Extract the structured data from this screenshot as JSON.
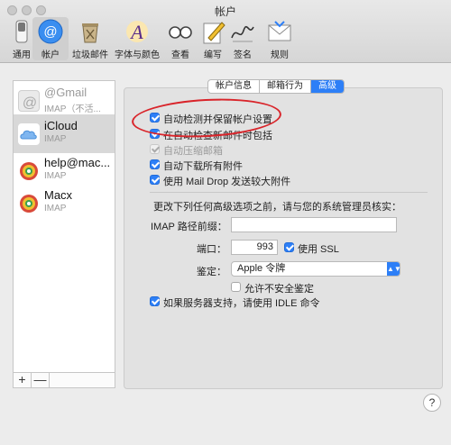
{
  "window": {
    "title": "帐户"
  },
  "toolbar": {
    "items": [
      {
        "label": "通用",
        "icon": "switch-icon"
      },
      {
        "label": "帐户",
        "icon": "at-sign-icon",
        "selected": true
      },
      {
        "label": "垃圾邮件",
        "icon": "trash-bin-icon"
      },
      {
        "label": "字体与颜色",
        "icon": "font-a-icon"
      },
      {
        "label": "查看",
        "icon": "glasses-icon"
      },
      {
        "label": "编写",
        "icon": "pencil-paper-icon"
      },
      {
        "label": "签名",
        "icon": "signature-icon"
      },
      {
        "label": "规则",
        "icon": "envelope-rules-icon"
      }
    ]
  },
  "accounts": [
    {
      "name": "@Gmail",
      "sub": "IMAP（不活...",
      "icon": "gmail-icon",
      "disabled": true
    },
    {
      "name": "iCloud",
      "sub": "IMAP",
      "icon": "icloud-icon",
      "selected": true
    },
    {
      "name": "help@mac...",
      "sub": "IMAP",
      "icon": "mail-account-icon"
    },
    {
      "name": "Macx",
      "sub": "IMAP",
      "icon": "mail-account-icon"
    }
  ],
  "sidebar_buttons": {
    "add": "+",
    "remove": "—"
  },
  "tabs": [
    {
      "label": "帐户信息"
    },
    {
      "label": "邮箱行为"
    },
    {
      "label": "高级",
      "active": true
    }
  ],
  "options": [
    {
      "label": "自动检测并保留帐户设置",
      "state": "on"
    },
    {
      "label": "在自动检查新邮件时包括",
      "state": "on"
    },
    {
      "label": "自动压缩邮箱",
      "state": "dim"
    },
    {
      "label": "自动下载所有附件",
      "state": "on"
    },
    {
      "label": "使用 Mail Drop 发送较大附件",
      "state": "on"
    }
  ],
  "advanced_note": "更改下列任何高级选项之前，请与您的系统管理员核实：",
  "imap_prefix": {
    "label": "IMAP 路径前缀：",
    "value": ""
  },
  "port": {
    "label": "端口：",
    "value": "993"
  },
  "use_ssl": {
    "label": "使用 SSL",
    "checked": true
  },
  "auth": {
    "label": "鉴定：",
    "value": "Apple 令牌"
  },
  "allow_insecure": {
    "label": "允许不安全鉴定",
    "checked": false
  },
  "idle": {
    "label": "如果服务器支持，请使用 IDLE 命令",
    "checked": true
  },
  "help_button": "?",
  "colors": {
    "accent": "#2d7ff7",
    "annotation": "#d9242a"
  }
}
